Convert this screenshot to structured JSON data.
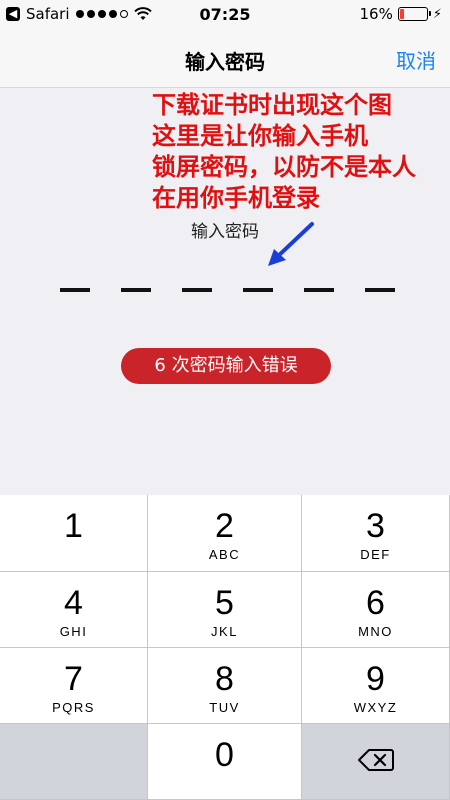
{
  "status_bar": {
    "back_app": "Safari",
    "time": "07:25",
    "battery_percent": "16%",
    "battery_level": 0.16,
    "signal_bars_filled": 4,
    "signal_bars_total": 5,
    "battery_color": "#ff3b30"
  },
  "navbar": {
    "title": "输入密码",
    "cancel_label": "取消",
    "accent_color": "#1a82fb"
  },
  "annotation": {
    "lines": [
      "下载证书时出现这个图",
      "这里是让你输入手机",
      "锁屏密码，以防不是本人",
      "在用你手机登录"
    ],
    "color": "#e01010"
  },
  "passcode": {
    "prompt": "输入密码",
    "digits_total": 6,
    "error_message": "6 次密码输入错误",
    "error_color": "#c8242a"
  },
  "keypad": {
    "keys": [
      {
        "num": "1",
        "letters": ""
      },
      {
        "num": "2",
        "letters": "ABC"
      },
      {
        "num": "3",
        "letters": "DEF"
      },
      {
        "num": "4",
        "letters": "GHI"
      },
      {
        "num": "5",
        "letters": "JKL"
      },
      {
        "num": "6",
        "letters": "MNO"
      },
      {
        "num": "7",
        "letters": "PQRS"
      },
      {
        "num": "8",
        "letters": "TUV"
      },
      {
        "num": "9",
        "letters": "WXYZ"
      },
      {
        "num": "0",
        "letters": ""
      }
    ],
    "delete_icon": "delete-backspace-icon"
  }
}
